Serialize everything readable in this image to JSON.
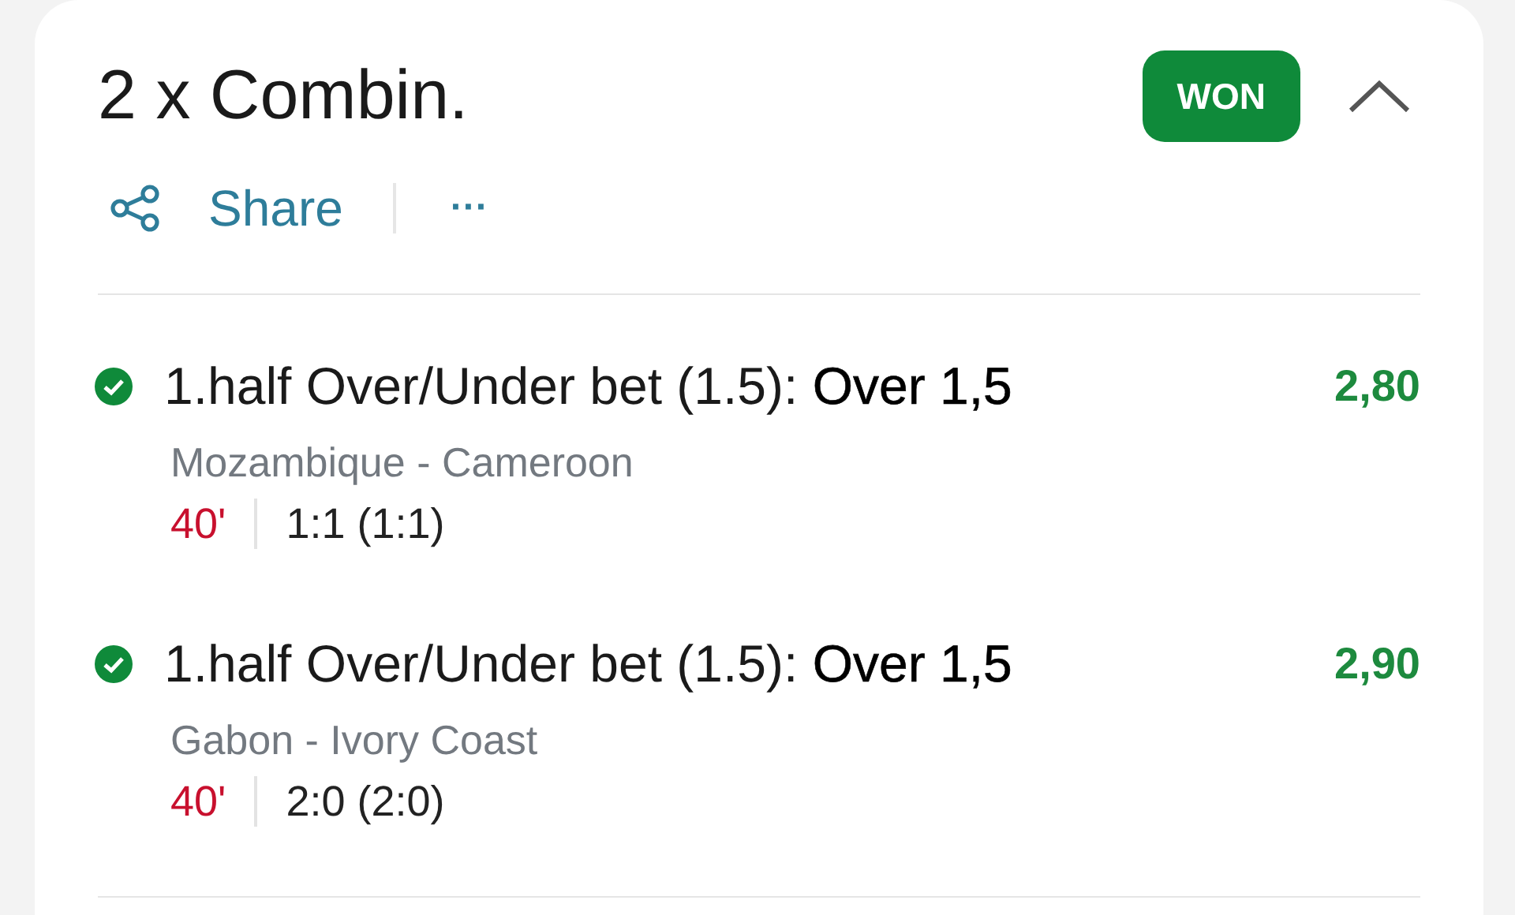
{
  "bet": {
    "title": "2 x Combin.",
    "won": true,
    "status_label": "WON",
    "expanded": true
  },
  "actions": {
    "share": "Share",
    "more": "···"
  },
  "selections": [
    {
      "won": true,
      "market": "1.half Over/Under bet (1.5): **Over 1,5**",
      "odds": "2,80",
      "match": "Mozambique - Cameroon",
      "minute": "40'",
      "score": "1:1 (1:1)"
    },
    {
      "won": true,
      "market": "1.half Over/Under bet (1.5): **Over 1,5**",
      "odds": "2,90",
      "match": "Gabon - Ivory Coast",
      "minute": "40'",
      "score": "2:0 (2:0)"
    }
  ]
}
